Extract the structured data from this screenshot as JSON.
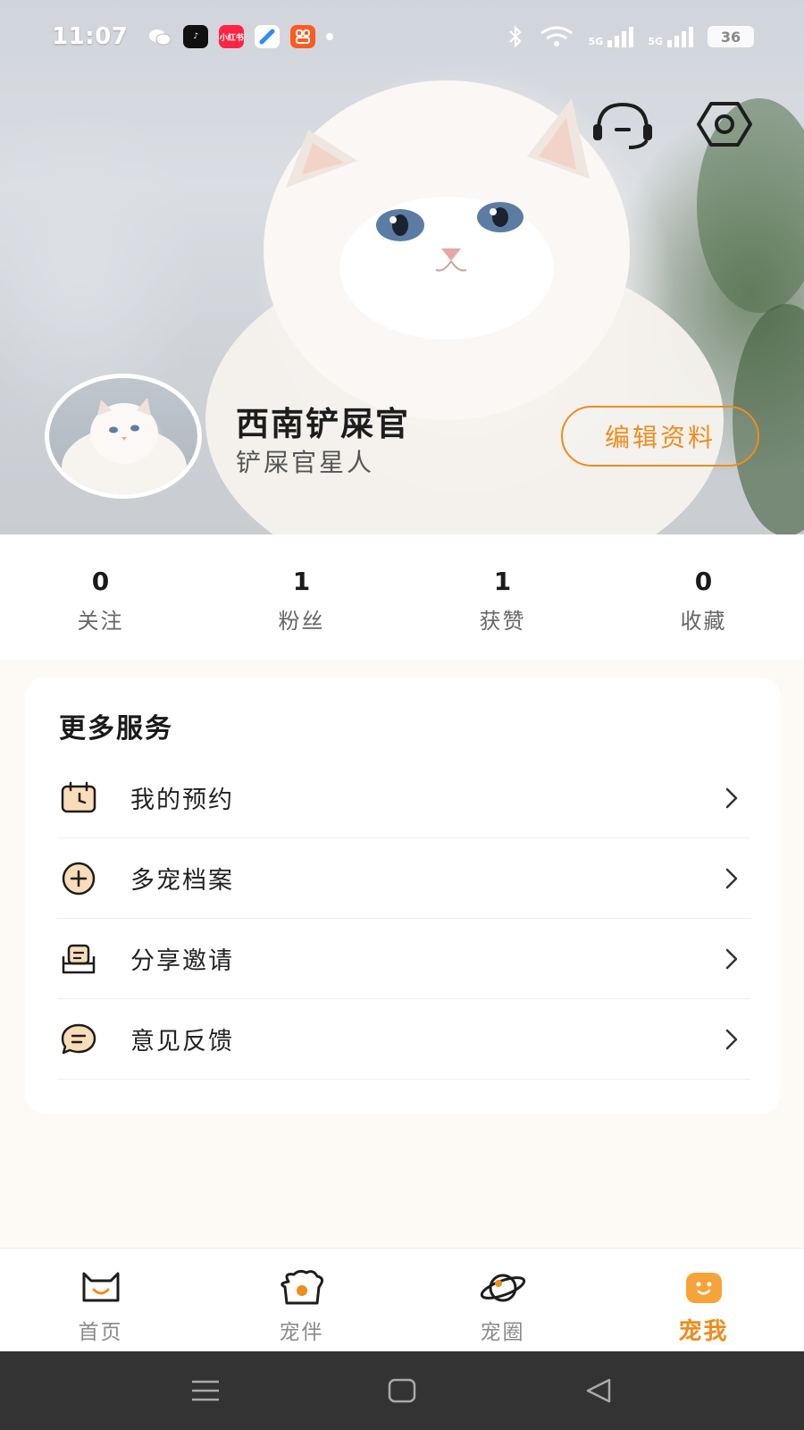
{
  "status_bar": {
    "time": "11:07",
    "apps": [
      {
        "name": "wechat-icon",
        "color": "#ffffff",
        "text": ""
      },
      {
        "name": "douyin-icon",
        "color": "#111111",
        "text": "♪"
      },
      {
        "name": "xiaohongshu-icon",
        "color": "#ff2442",
        "text": "小红书"
      },
      {
        "name": "chat-app-icon",
        "color": "#2f8df5",
        "text": ""
      },
      {
        "name": "taobao-app-icon",
        "color": "#ff5a1f",
        "text": ""
      }
    ],
    "network": "5G",
    "battery": "36"
  },
  "profile": {
    "name": "西南铲屎官",
    "subtitle": "铲屎官星人",
    "edit_label": "编辑资料"
  },
  "stats": [
    {
      "value": "0",
      "label": "关注"
    },
    {
      "value": "1",
      "label": "粉丝"
    },
    {
      "value": "1",
      "label": "获赞"
    },
    {
      "value": "0",
      "label": "收藏"
    }
  ],
  "services": {
    "title": "更多服务",
    "items": [
      {
        "label": "我的预约",
        "icon": "calendar-icon"
      },
      {
        "label": "多宠档案",
        "icon": "add-circle-icon"
      },
      {
        "label": "分享邀请",
        "icon": "share-envelope-icon"
      },
      {
        "label": "意见反馈",
        "icon": "feedback-chat-icon"
      }
    ]
  },
  "tabbar": {
    "tabs": [
      {
        "label": "首页",
        "icon": "home-cat-icon",
        "active": false
      },
      {
        "label": "宠伴",
        "icon": "pet-companion-icon",
        "active": false
      },
      {
        "label": "宠圈",
        "icon": "planet-icon",
        "active": false
      },
      {
        "label": "宠我",
        "icon": "me-face-icon",
        "active": true
      }
    ]
  },
  "colors": {
    "accent": "#ef8c1c",
    "icon_fill": "#f9ddb8",
    "page_bg": "#fdf9f5",
    "sysnav_bg": "#333333"
  }
}
